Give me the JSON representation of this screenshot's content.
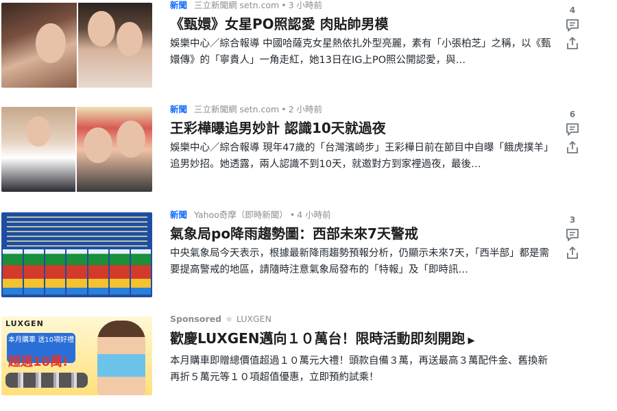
{
  "items": [
    {
      "category": "新聞",
      "source": "三立新聞網 setn.com",
      "time": "3 小時前",
      "title": "《甄嬛》女星PO照認愛 肉貼帥男模",
      "summary": "娛樂中心／綜合報導 中國哈薩克女星熱依扎外型亮麗，素有「小張柏芝」之稱，以《甄嬛傳》的「寧貴人」一角走紅，她13日在IG上PO照公開認愛，與…",
      "comment_count": "4"
    },
    {
      "category": "新聞",
      "source": "三立新聞網 setn.com",
      "time": "2 小時前",
      "title": "王彩樺曝追男妙計 認識10天就過夜",
      "summary": "娛樂中心／綜合報導 現年47歲的「台灣濱崎步」王彩樺日前在節目中自曝「餓虎撲羊」追男妙招。她透露，兩人認識不到10天，就邀對方到家裡過夜，最後…",
      "comment_count": "6"
    },
    {
      "category": "新聞",
      "source": "Yahoo奇摩（即時新聞）",
      "time": "4 小時前",
      "title": "氣象局po降雨趨勢圖：西部未來7天警戒",
      "summary": "中央氣象局今天表示，根據最新降雨趨勢預報分析，仍顯示未來7天，「西半部」都是需要提高警戒的地區，請隨時注意氣象局發布的「特報」及「即時訊…",
      "comment_count": "3"
    },
    {
      "sponsored_label": "Sponsored",
      "advertiser": "LUXGEN",
      "title": "歡慶LUXGEN邁向１０萬台！限時活動即刻開跑",
      "summary": "本月購車即贈總價值超過１０萬元大禮！頭款自備３萬，再送最高３萬配件金、舊換新再折５萬元等１０項超值優惠，立即預約試乘！",
      "ad_image": {
        "logo": "LUXGEN",
        "badge": "本月購車 送10項好禮",
        "headline": "超過10萬!"
      }
    }
  ],
  "colors": {
    "category": "#0f69ff",
    "meta": "#8d8d8f",
    "title": "#1d1d1f",
    "icon": "#6e7780"
  },
  "icons": {
    "comment": "comment-icon",
    "share": "share-icon",
    "sponsored": "sun-icon",
    "play": "play-triangle-icon"
  }
}
